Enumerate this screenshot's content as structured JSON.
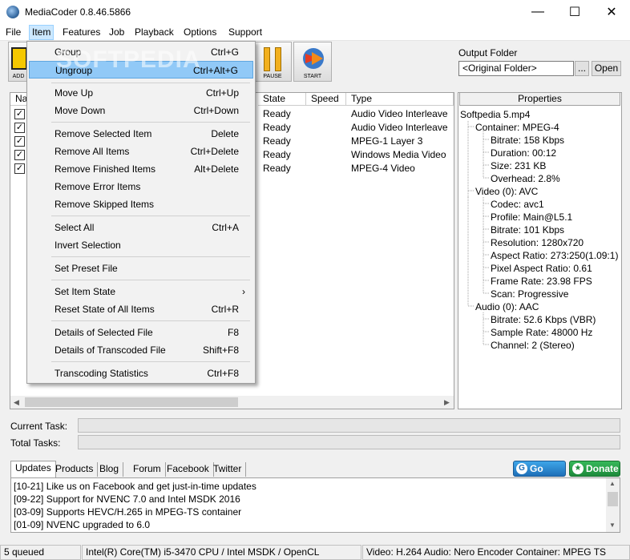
{
  "window": {
    "title": "MediaCoder 0.8.46.5866",
    "minimize": "—",
    "maximize": "☐",
    "close": "✕"
  },
  "menubar": [
    "File",
    "Item",
    "Features",
    "Job",
    "Playback",
    "Options",
    "Support"
  ],
  "toolbar": {
    "add_label": "ADD",
    "pause_label": "PAUSE",
    "start_label": "START"
  },
  "output_folder": {
    "label": "Output Folder",
    "value": "<Original Folder>",
    "browse_label": "...",
    "open_label": "Open"
  },
  "file_list": {
    "columns": [
      "Na",
      "State",
      "Speed",
      "Type"
    ],
    "rows": [
      {
        "state": "Ready",
        "type": "Audio Video Interleave"
      },
      {
        "state": "Ready",
        "type": "Audio Video Interleave"
      },
      {
        "state": "Ready",
        "type": "MPEG-1 Layer 3"
      },
      {
        "state": "Ready",
        "type": "Windows Media Video"
      },
      {
        "state": "Ready",
        "type": "MPEG-4 Video"
      }
    ]
  },
  "properties": {
    "header": "Properties",
    "lines": [
      "Softpedia 5.mp4",
      "Container: MPEG-4",
      "Bitrate: 158 Kbps",
      "Duration: 00:12",
      "Size: 231 KB",
      "Overhead: 2.8%",
      "Video (0): AVC",
      "Codec: avc1",
      "Profile: Main@L5.1",
      "Bitrate: 101 Kbps",
      "Resolution: 1280x720",
      "Aspect Ratio: 273:250(1.09:1)",
      "Pixel Aspect Ratio: 0.61",
      "Frame Rate: 23.98 FPS",
      "Scan: Progressive",
      "Audio (0): AAC",
      "Bitrate: 52.6 Kbps (VBR)",
      "Sample Rate: 48000 Hz",
      "Channel: 2 (Stereo)"
    ]
  },
  "progress": {
    "current_label": "Current Task:",
    "total_label": "Total Tasks:"
  },
  "tabs": [
    "Updates",
    "Products",
    "Blog",
    "Forum",
    "Facebook",
    "Twitter"
  ],
  "buttons": {
    "gopro_label": "Go PRO",
    "donate_label": "Donate"
  },
  "news": [
    "[10-21] Like us on Facebook and get just-in-time updates",
    "[09-22] Support for NVENC 7.0 and Intel MSDK 2016",
    "[03-09] Supports HEVC/H.265 in MPEG-TS container",
    "[01-09] NVENC upgraded to 6.0"
  ],
  "status": {
    "queued": "5 queued",
    "cpu": "Intel(R) Core(TM) i5-3470 CPU  / Intel MSDK / OpenCL",
    "codec": "Video: H.264  Audio: Nero Encoder  Container: MPEG TS"
  },
  "item_menu": {
    "group": {
      "label": "Group",
      "shortcut": "Ctrl+G"
    },
    "ungroup": {
      "label": "Ungroup",
      "shortcut": "Ctrl+Alt+G"
    },
    "move_up": {
      "label": "Move Up",
      "shortcut": "Ctrl+Up"
    },
    "move_down": {
      "label": "Move Down",
      "shortcut": "Ctrl+Down"
    },
    "remove_selected": {
      "label": "Remove Selected Item",
      "shortcut": "Delete"
    },
    "remove_all": {
      "label": "Remove All Items",
      "shortcut": "Ctrl+Delete"
    },
    "remove_finished": {
      "label": "Remove Finished Items",
      "shortcut": "Alt+Delete"
    },
    "remove_error": {
      "label": "Remove Error Items",
      "shortcut": ""
    },
    "remove_skipped": {
      "label": "Remove Skipped Items",
      "shortcut": ""
    },
    "select_all": {
      "label": "Select All",
      "shortcut": "Ctrl+A"
    },
    "invert_selection": {
      "label": "Invert Selection",
      "shortcut": ""
    },
    "set_preset": {
      "label": "Set Preset File",
      "shortcut": ""
    },
    "set_item_state": {
      "label": "Set Item State",
      "shortcut": "›"
    },
    "reset_state": {
      "label": "Reset State of All Items",
      "shortcut": "Ctrl+R"
    },
    "details_selected": {
      "label": "Details of Selected File",
      "shortcut": "F8"
    },
    "details_transcoded": {
      "label": "Details of Transcoded File",
      "shortcut": "Shift+F8"
    },
    "transcoding_stats": {
      "label": "Transcoding Statistics",
      "shortcut": "Ctrl+F8"
    }
  },
  "watermark": "SOFTPEDIA"
}
